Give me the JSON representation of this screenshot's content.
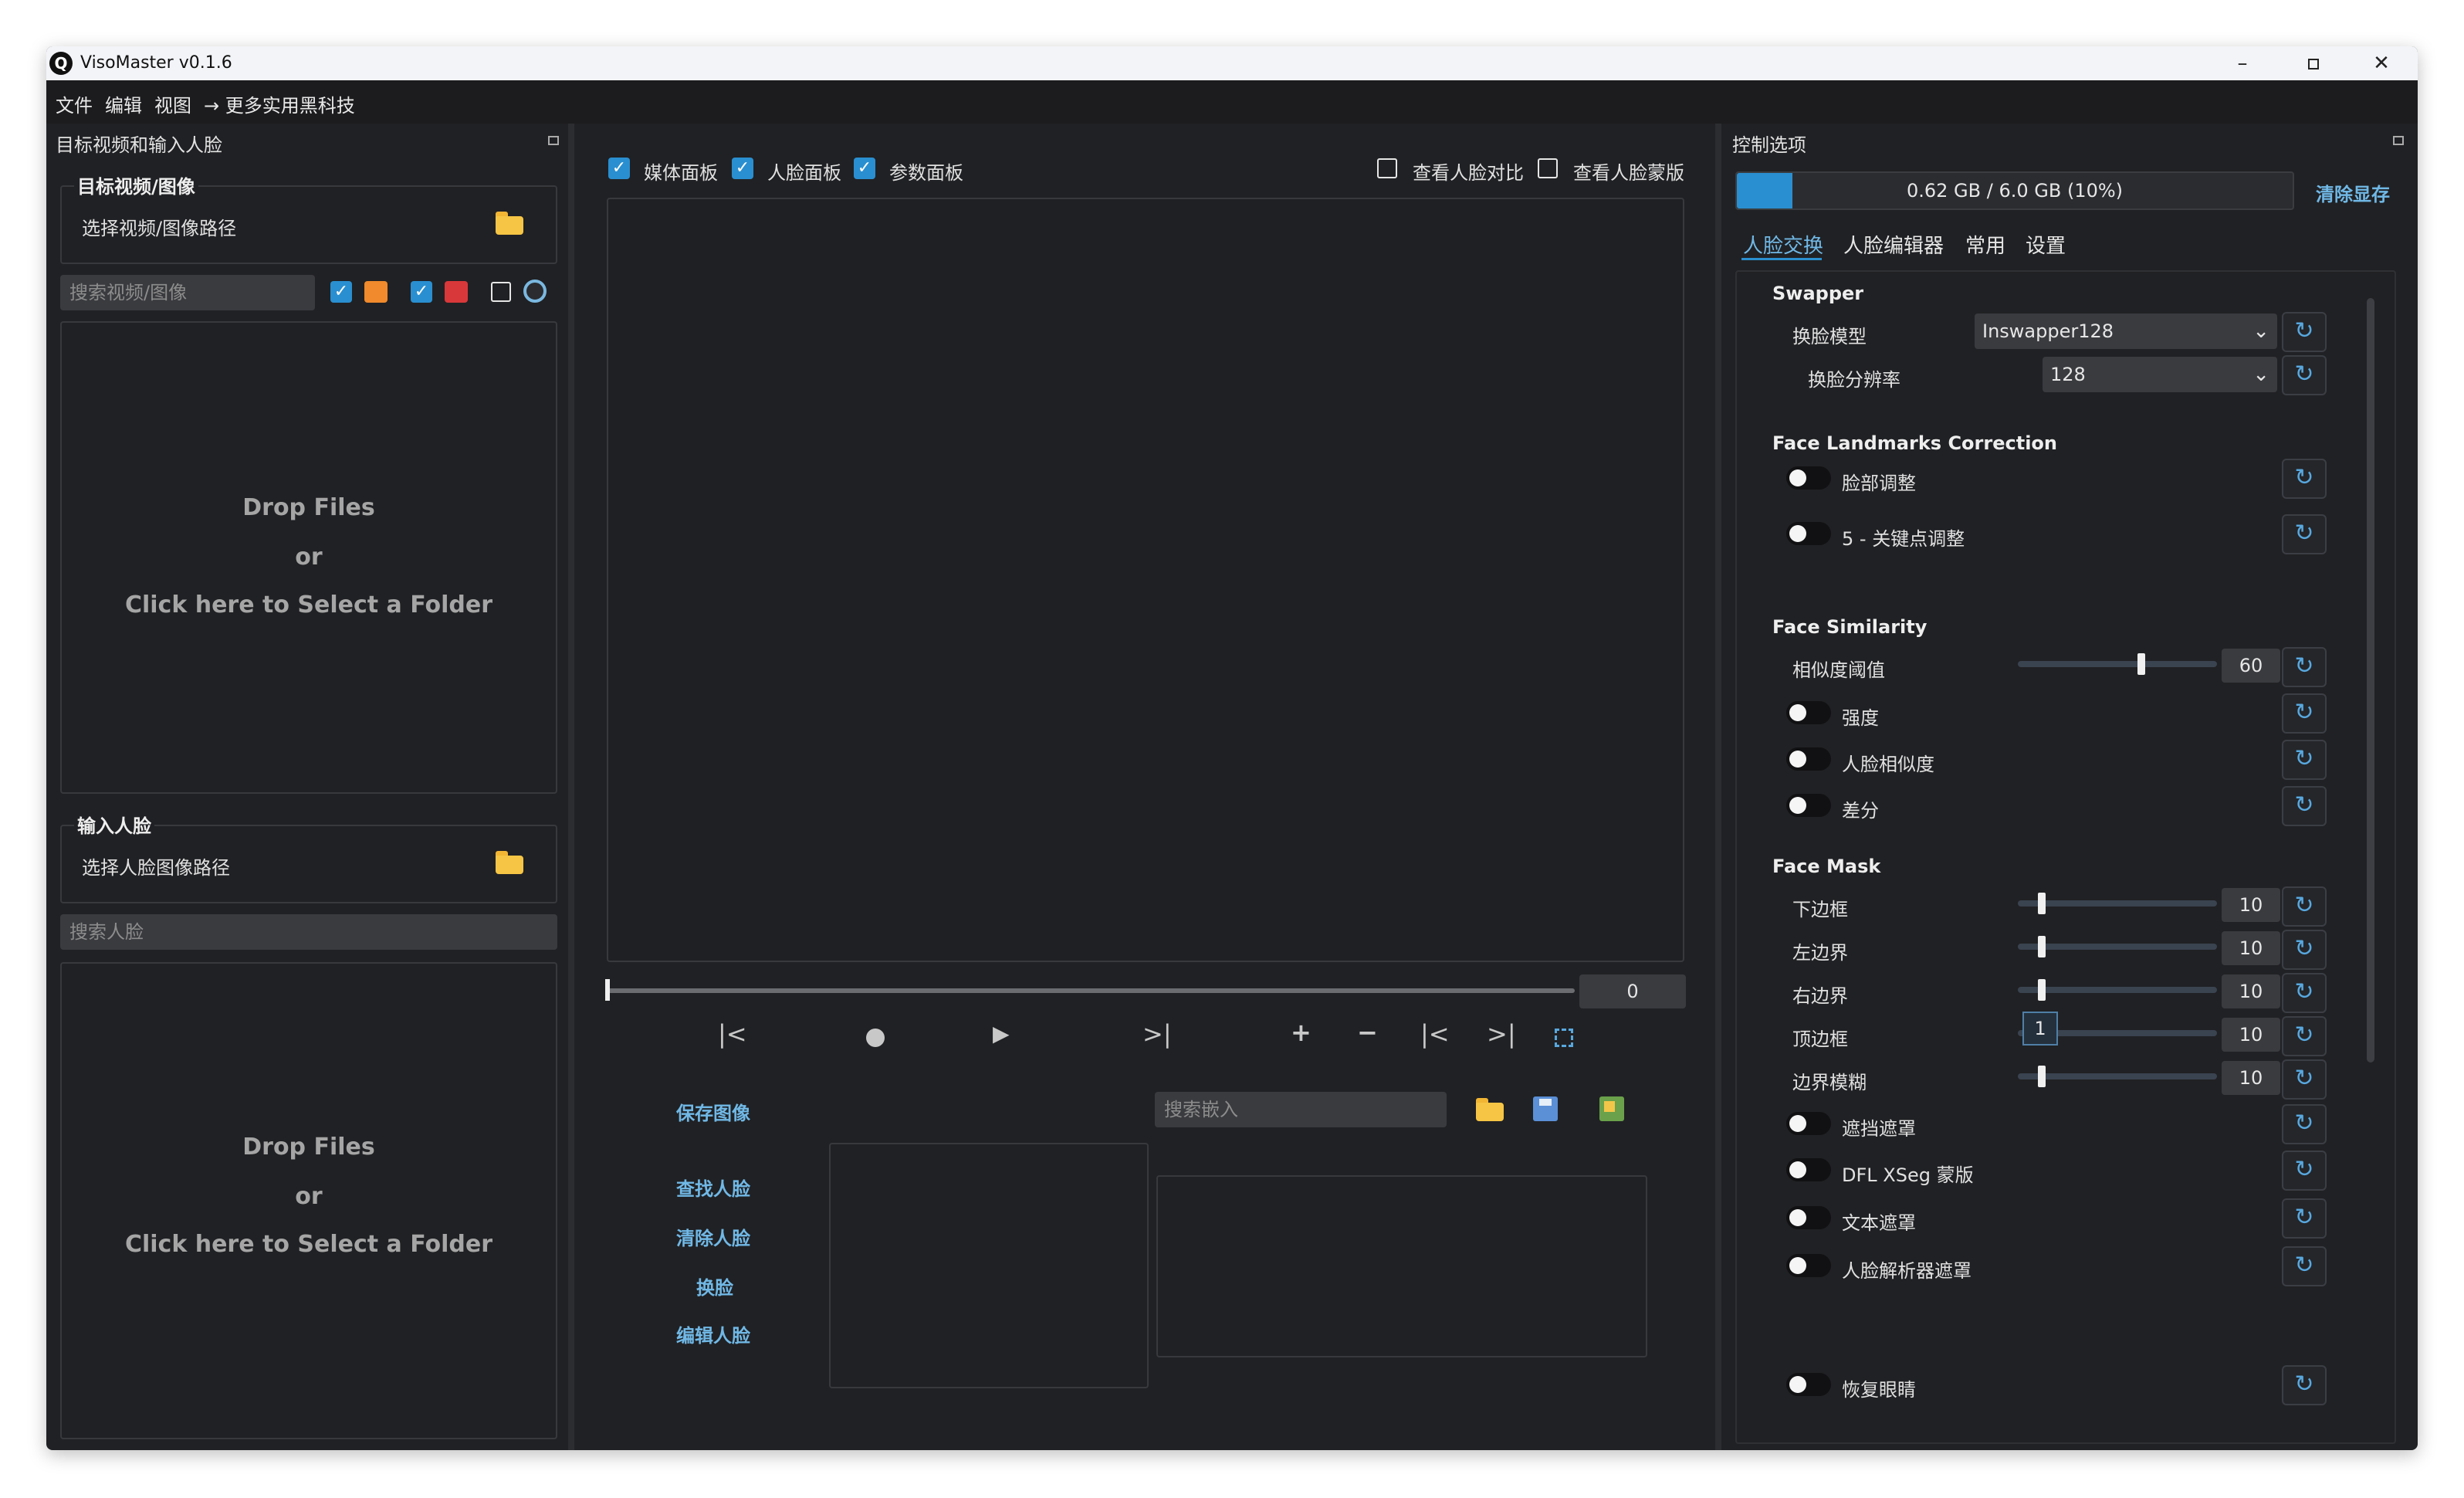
{
  "window": {
    "title": "VisoMaster v0.1.6",
    "logo": "Q"
  },
  "menu": [
    "文件",
    "编辑",
    "视图",
    "→ 更多实用黑科技"
  ],
  "left_panel": {
    "header": "目标视频和输入人脸",
    "target_section": "目标视频/图像",
    "select_target_path": "选择视频/图像路径",
    "target_search_placeholder": "搜索视频/图像",
    "drop_line1": "Drop Files",
    "drop_line2": "or",
    "drop_line3": "Click here to Select a Folder",
    "input_face_section": "输入人脸",
    "select_face_path": "选择人脸图像路径",
    "face_search_placeholder": "搜索人脸"
  },
  "center": {
    "cb_media": "媒体面板",
    "cb_face": "人脸面板",
    "cb_params": "参数面板",
    "cb_compare": "查看人脸对比",
    "cb_mask": "查看人脸蒙版",
    "frame_value": "0",
    "save_image": "保存图像",
    "find_faces": "查找人脸",
    "clear_faces": "清除人脸",
    "swap": "换脸",
    "edit_faces": "编辑人脸",
    "embed_search_placeholder": "搜索嵌入"
  },
  "right_panel": {
    "header": "控制选项",
    "memory_text": "0.62 GB / 6.0 GB (10%)",
    "memory_fraction": 0.1,
    "clear_memory": "清除显存",
    "tabs": [
      "人脸交换",
      "人脸编辑器",
      "常用",
      "设置"
    ],
    "swapper": {
      "title": "Swapper",
      "model_label": "换脸模型",
      "model_value": "Inswapper128",
      "res_label": "换脸分辨率",
      "res_value": "128"
    },
    "landmarks": {
      "title": "Face Landmarks Correction",
      "face_adjust": "脸部调整",
      "kp_adjust": "5 - 关键点调整"
    },
    "similarity": {
      "title": "Face Similarity",
      "threshold_label": "相似度阈值",
      "threshold_value": "60",
      "threshold_fraction": 0.6,
      "strength": "强度",
      "face_likeness": "人脸相似度",
      "diff": "差分"
    },
    "mask": {
      "title": "Face Mask",
      "bottom": "下边框",
      "left": "左边界",
      "right": "右边界",
      "top": "顶边框",
      "blur": "边界模糊",
      "value": "10",
      "tooltip": "1",
      "occlusion": "遮挡遮罩",
      "dfl": "DFL XSeg 蒙版",
      "text_mask": "文本遮罩",
      "parser": "人脸解析器遮罩",
      "restore_eyes": "恢复眼睛"
    }
  }
}
